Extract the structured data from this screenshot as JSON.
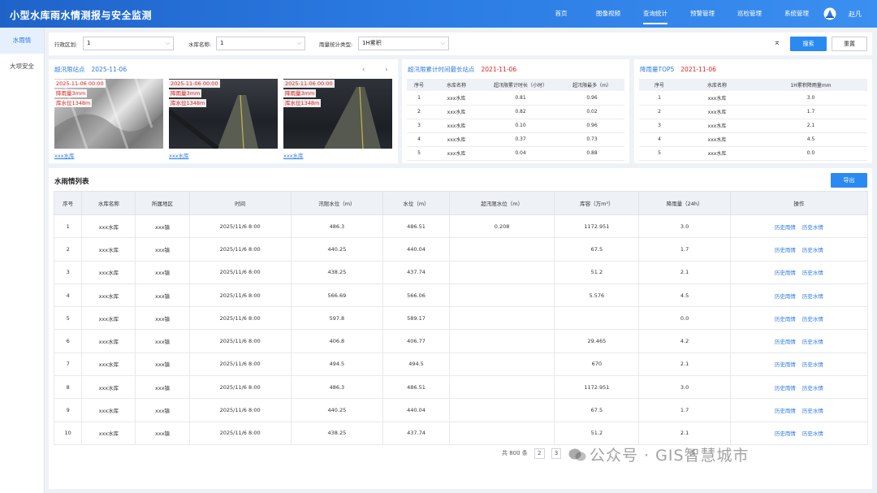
{
  "header": {
    "title": "小型水库雨水情测报与安全监测",
    "nav": [
      "首页",
      "图像视频",
      "查询统计",
      "预警管理",
      "巡检管理",
      "系统管理"
    ],
    "active_nav": "查询统计",
    "user": "赵凡"
  },
  "sidebar": {
    "items": [
      {
        "label": "水雨情",
        "active": true
      },
      {
        "label": "大坝安全",
        "active": false
      }
    ]
  },
  "filter": {
    "region_label": "行政区划:",
    "region_value": "1",
    "reservoir_label": "水库名称:",
    "reservoir_value": "1",
    "rain_type_label": "雨量统计类型:",
    "rain_type_value": "1H累积",
    "search_label": "搜索",
    "reset_label": "重置"
  },
  "panel_photos": {
    "title": "超汛限站点",
    "date": "2025-11-06",
    "photos": [
      {
        "time": "2025-11-06 00:00",
        "rain": "降雨量3mm",
        "level": "库水位1348m",
        "link": "xxx水库"
      },
      {
        "time": "2025-11-06 00:00",
        "rain": "降雨量3mm",
        "level": "库水位1348m",
        "link": "xxx水库"
      },
      {
        "time": "2025-11-06 00:00",
        "rain": "降雨量3mm",
        "level": "库水位1348m",
        "link": "xxx水库"
      }
    ]
  },
  "panel_over": {
    "title": "超汛限累计时间最长站点",
    "date": "2021-11-06",
    "headers": [
      "序号",
      "水库名称",
      "超汛限累计时长（小时）",
      "超汛限最多（m）"
    ],
    "rows": [
      [
        "1",
        "xxx水库",
        "0.81",
        "0.96"
      ],
      [
        "2",
        "xxx水库",
        "0.82",
        "0.02"
      ],
      [
        "3",
        "xxx水库",
        "0.10",
        "0.96"
      ],
      [
        "4",
        "xxx水库",
        "0.37",
        "0.73"
      ],
      [
        "5",
        "xxx水库",
        "0.04",
        "0.88"
      ]
    ]
  },
  "panel_rain": {
    "title": "降雨量TOP5",
    "date": "2021-11-06",
    "headers": [
      "序号",
      "水库名称",
      "1H累积降雨量mm"
    ],
    "rows": [
      [
        "1",
        "xxx水库",
        "3.0"
      ],
      [
        "2",
        "xxx水库",
        "1.7"
      ],
      [
        "3",
        "xxx水库",
        "2.1"
      ],
      [
        "4",
        "xxx水库",
        "4.5"
      ],
      [
        "5",
        "xxx水库",
        "0.0"
      ]
    ]
  },
  "list": {
    "title": "水雨情列表",
    "export_label": "导出",
    "headers": [
      "序号",
      "水库名称",
      "所属地区",
      "时间",
      "汛限水位（m）",
      "水位（m）",
      "超汛限水位（m）",
      "库容（万m³）",
      "降雨量（24h）",
      "操作"
    ],
    "op_labels": [
      "历史雨情",
      "历史水情"
    ],
    "rows": [
      [
        "1",
        "xxx水库",
        "xxx镇",
        "2025/11/6 8:00",
        "486.3",
        "486.51",
        "0.208",
        "1172.951",
        "3.0"
      ],
      [
        "2",
        "xxx水库",
        "xxx镇",
        "2025/11/6 8:00",
        "440.25",
        "440.04",
        "",
        "67.5",
        "1.7"
      ],
      [
        "3",
        "xxx水库",
        "xxx镇",
        "2025/11/6 8:00",
        "438.25",
        "437.74",
        "",
        "51.2",
        "2.1"
      ],
      [
        "4",
        "xxx水库",
        "xxx镇",
        "2025/11/6 8:00",
        "566.69",
        "566.06",
        "",
        "5.576",
        "4.5"
      ],
      [
        "5",
        "xxx水库",
        "xxx镇",
        "2025/11/6 8:00",
        "597.8",
        "589.17",
        "",
        "",
        "0.0"
      ],
      [
        "6",
        "xxx水库",
        "xxx镇",
        "2025/11/6 8:00",
        "406.8",
        "406.77",
        "",
        "29.465",
        "4.2"
      ],
      [
        "7",
        "xxx水库",
        "xxx镇",
        "2025/11/6 8:00",
        "494.5",
        "494.5",
        "",
        "670",
        "2.1"
      ],
      [
        "8",
        "xxx水库",
        "xxx镇",
        "2025/11/6 8:00",
        "486.3",
        "486.51",
        "",
        "1172.951",
        "3.0"
      ],
      [
        "9",
        "xxx水库",
        "xxx镇",
        "2025/11/6 8:00",
        "440.25",
        "440.04",
        "",
        "67.5",
        "1.7"
      ],
      [
        "10",
        "xxx水库",
        "xxx镇",
        "2025/11/6 8:00",
        "438.25",
        "437.74",
        "",
        "51.2",
        "2.1"
      ]
    ]
  },
  "pager": {
    "total": "共 800 条",
    "pages": [
      "2",
      "3"
    ],
    "suffix": "页"
  },
  "watermark": "公众号 · GIS智慧城市",
  "colors": {
    "accent": "#2a7ae2",
    "alert": "#e02020",
    "header_start": "#1f63c9",
    "header_end": "#3b8ff0"
  }
}
